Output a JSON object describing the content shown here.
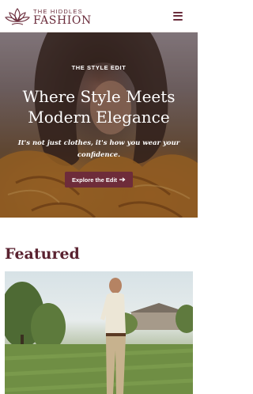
{
  "header": {
    "brand_top": "THE HIDDLES",
    "brand_bottom": "FASHION",
    "menu_icon": "hamburger-menu-icon",
    "brand_color": "#6b2d3c"
  },
  "hero": {
    "eyebrow": "THE STYLE EDIT",
    "title": "Where Style Meets Modern Elegance",
    "subtitle": "It's not just clothes, it's how you wear your confidence.",
    "cta_label": "Explore the Edit",
    "cta_icon": "arrow-right-icon",
    "cta_color": "#6e2c3a"
  },
  "featured": {
    "title": "Featured"
  }
}
